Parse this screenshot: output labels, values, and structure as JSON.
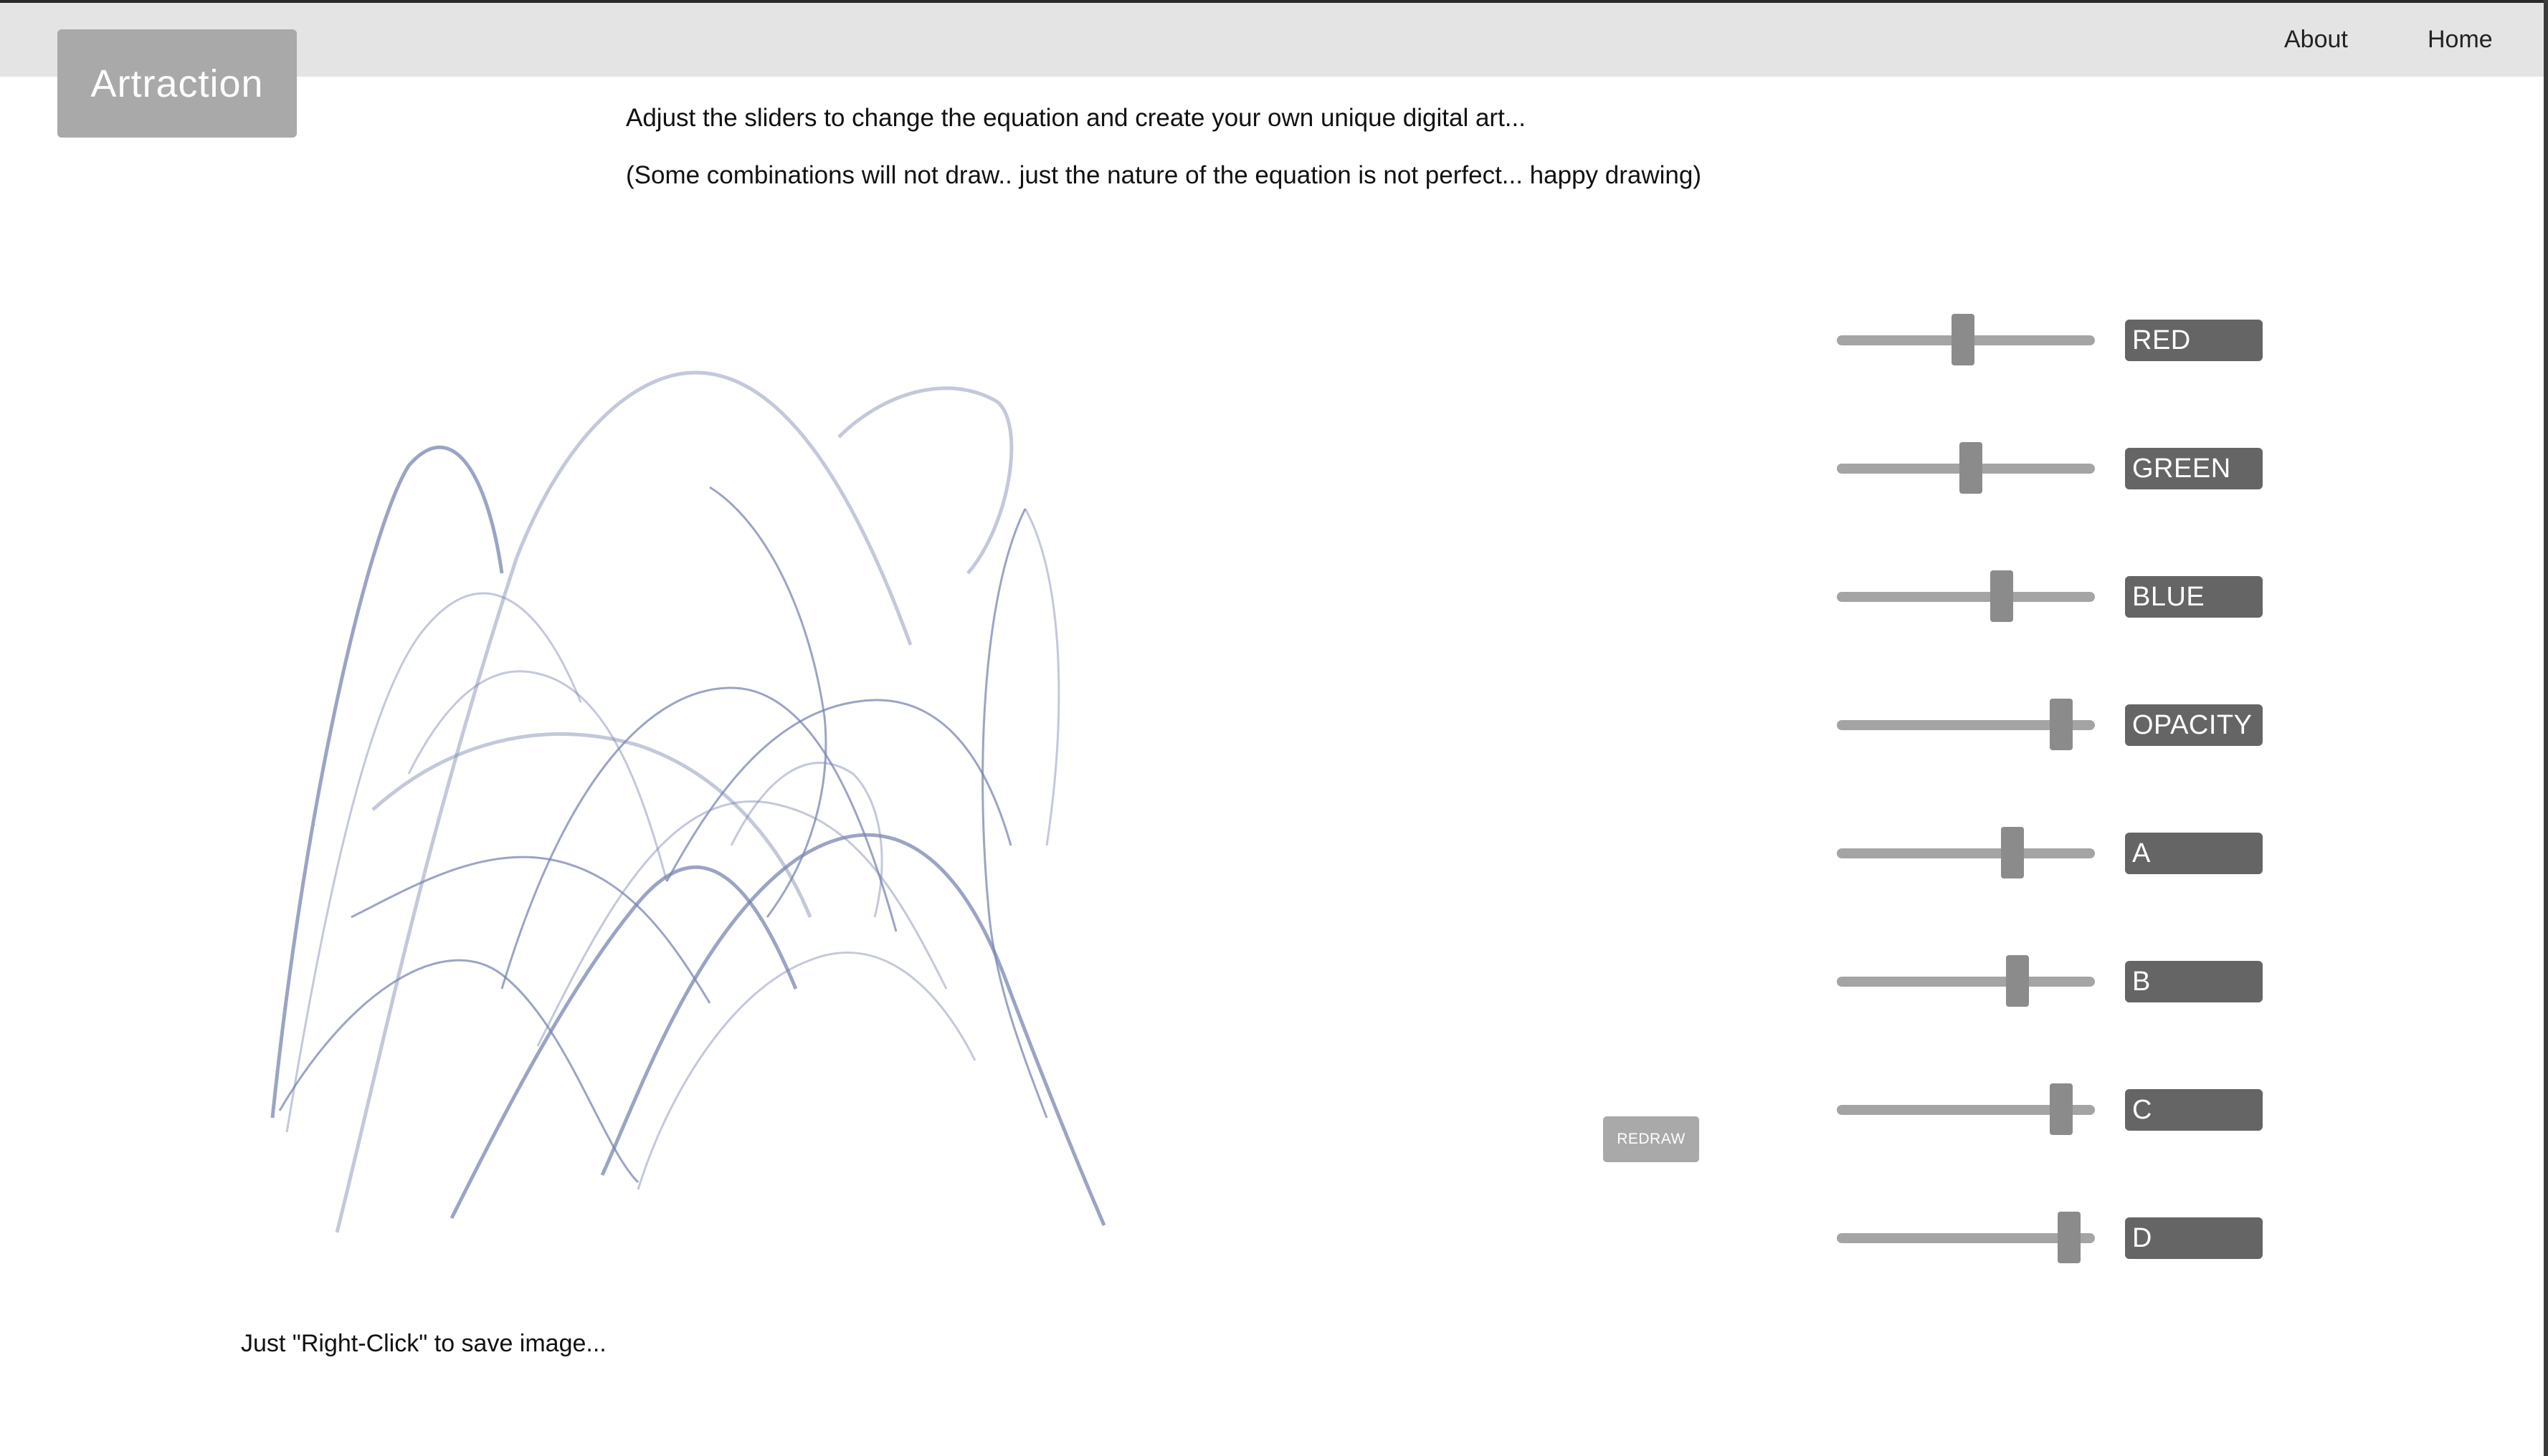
{
  "header": {
    "logo": "Artraction",
    "nav": {
      "about": "About",
      "home": "Home"
    }
  },
  "intro": {
    "line1": "Adjust the sliders to change the equation and create your own unique digital art...",
    "line2": "(Some combinations will not draw.. just the nature of the equation is not perfect... happy drawing)"
  },
  "canvas": {
    "stroke_color": "#7a86b0"
  },
  "footer": {
    "save_note": "Just \"Right-Click\" to save image..."
  },
  "controls": {
    "redraw_label": "REDRAW",
    "sliders": [
      {
        "label": "RED",
        "value": 0.49
      },
      {
        "label": "GREEN",
        "value": 0.52
      },
      {
        "label": "BLUE",
        "value": 0.64
      },
      {
        "label": "OPACITY",
        "value": 0.87
      },
      {
        "label": "A",
        "value": 0.68
      },
      {
        "label": "B",
        "value": 0.7
      },
      {
        "label": "C",
        "value": 0.87
      },
      {
        "label": "D",
        "value": 0.9
      }
    ]
  },
  "colors": {
    "topbar": "#e4e4e4",
    "logo_bg": "#a9a9a9",
    "label_bg": "#656565",
    "track": "#a4a4a4",
    "thumb": "#8b8b8b"
  }
}
